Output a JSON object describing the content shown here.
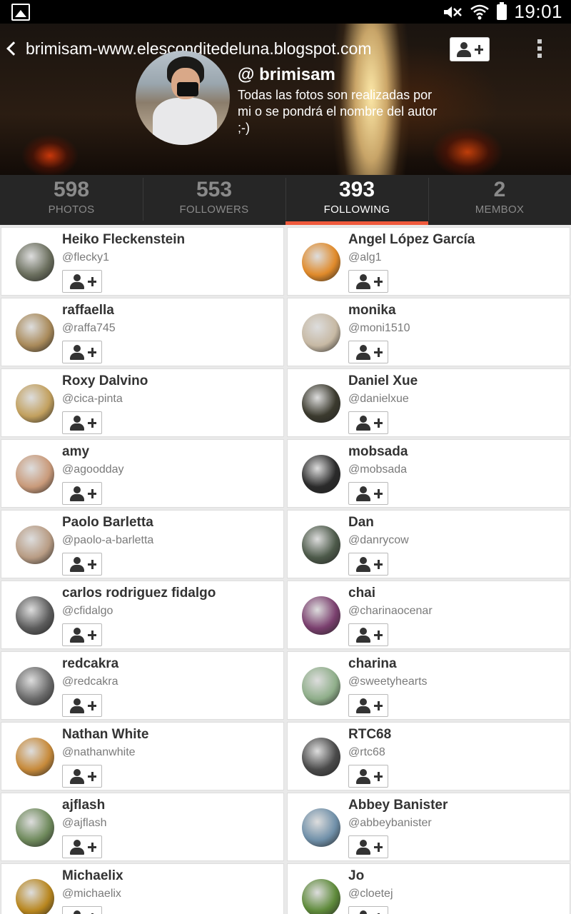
{
  "status_bar": {
    "time": "19:01"
  },
  "profile": {
    "title": "brimisam-www.elesconditedeluna.blogspot.com",
    "username": "@ brimisam",
    "bio": "Todas las fotos son realizadas por mi o se pondrá el nombre del autor ;-)"
  },
  "tabs": [
    {
      "count": "598",
      "label": "PHOTOS"
    },
    {
      "count": "553",
      "label": "FOLLOWERS"
    },
    {
      "count": "393",
      "label": "FOLLOWING",
      "active": true
    },
    {
      "count": "2",
      "label": "MEMBOX"
    }
  ],
  "users": [
    {
      "name": "Heiko Fleckenstein",
      "handle": "@flecky1",
      "avatar_color": "#6b6f5e"
    },
    {
      "name": "Angel López García",
      "handle": "@alg1",
      "avatar_color": "#e08a2a"
    },
    {
      "name": "raffaella",
      "handle": "@raffa745",
      "avatar_color": "#a98a5a"
    },
    {
      "name": "monika",
      "handle": "@moni1510",
      "avatar_color": "#c7b9a4"
    },
    {
      "name": "Roxy Dalvino",
      "handle": "@cica-pinta",
      "avatar_color": "#c2a05e"
    },
    {
      "name": "Daniel Xue",
      "handle": "@danielxue",
      "avatar_color": "#3b3a2e"
    },
    {
      "name": "amy",
      "handle": "@agoodday",
      "avatar_color": "#c99a7a"
    },
    {
      "name": "mobsada",
      "handle": "@mobsada",
      "avatar_color": "#2a2a2a"
    },
    {
      "name": "Paolo Barletta",
      "handle": "@paolo-a-barletta",
      "avatar_color": "#b89c84"
    },
    {
      "name": "Dan",
      "handle": "@danrycow",
      "avatar_color": "#4d5a4a"
    },
    {
      "name": "carlos rodriguez fidalgo",
      "handle": "@cfidalgo",
      "avatar_color": "#5c5c5c"
    },
    {
      "name": "chai",
      "handle": "@charinaocenar",
      "avatar_color": "#7a3f6e"
    },
    {
      "name": "redcakra",
      "handle": "@redcakra",
      "avatar_color": "#6a6a6a"
    },
    {
      "name": "charina",
      "handle": "@sweetyhearts",
      "avatar_color": "#8fae8a"
    },
    {
      "name": "Nathan White",
      "handle": "@nathanwhite",
      "avatar_color": "#c78a3a"
    },
    {
      "name": "RTC68",
      "handle": "@rtc68",
      "avatar_color": "#4a4a4a"
    },
    {
      "name": "ajflash",
      "handle": "@ajflash",
      "avatar_color": "#6f8a5c"
    },
    {
      "name": "Abbey Banister",
      "handle": "@abbeybanister",
      "avatar_color": "#6f8fa8"
    },
    {
      "name": "Michaelix",
      "handle": "@michaelix",
      "avatar_color": "#b8861e"
    },
    {
      "name": "Jo",
      "handle": "@cloetej",
      "avatar_color": "#5e8a3a"
    }
  ]
}
